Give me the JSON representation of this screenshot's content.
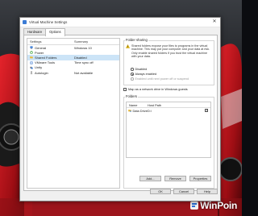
{
  "window": {
    "title": "Virtual Machine Settings",
    "close_glyph": "✕"
  },
  "tabs": [
    {
      "label": "Hardware"
    },
    {
      "label": "Options"
    }
  ],
  "settings_list": {
    "headers": {
      "setting": "Settings",
      "summary": "Summary"
    },
    "rows": [
      {
        "icon": "general-icon",
        "setting": "General",
        "summary": "Windows 10"
      },
      {
        "icon": "power-icon",
        "setting": "Power",
        "summary": ""
      },
      {
        "icon": "shared-folders-icon",
        "setting": "Shared Folders",
        "summary": "Disabled"
      },
      {
        "icon": "vmware-tools-icon",
        "setting": "VMware Tools",
        "summary": "Time sync off"
      },
      {
        "icon": "unity-icon",
        "setting": "Unity",
        "summary": ""
      },
      {
        "icon": "autologin-icon",
        "setting": "Autologin",
        "summary": "Not available"
      }
    ],
    "selected_index": 2
  },
  "folder_sharing": {
    "label": "Folder sharing",
    "warning": "Shared folders expose your files to programs in the virtual machine. This may put your computer and your data at risk. Only enable shared folders if you trust the virtual machine with your data.",
    "options": [
      {
        "label": "Disabled",
        "selected": false,
        "enabled": true
      },
      {
        "label": "Always enabled",
        "selected": true,
        "enabled": true
      },
      {
        "label": "Enabled until next power off or suspend",
        "selected": false,
        "enabled": false
      }
    ],
    "map_network_drive": {
      "label": "Map as a network drive in Windows guests",
      "checked": false
    }
  },
  "folders": {
    "label": "Folders",
    "headers": {
      "name": "Name",
      "host_path": "Host Path"
    },
    "rows": [
      {
        "name": "Data Drive",
        "host_path": "D:\\",
        "enabled": true
      }
    ],
    "buttons": {
      "add": "Add...",
      "remove": "Remove",
      "properties": "Properties"
    }
  },
  "footer": {
    "ok": "OK",
    "cancel": "Cancel",
    "help": "Help"
  },
  "wallpaper": {
    "brand": "WinPoin"
  },
  "colors": {
    "selection": "#cce4f7",
    "car_red": "#c0141b",
    "accent_blue": "#3a7bd5"
  }
}
